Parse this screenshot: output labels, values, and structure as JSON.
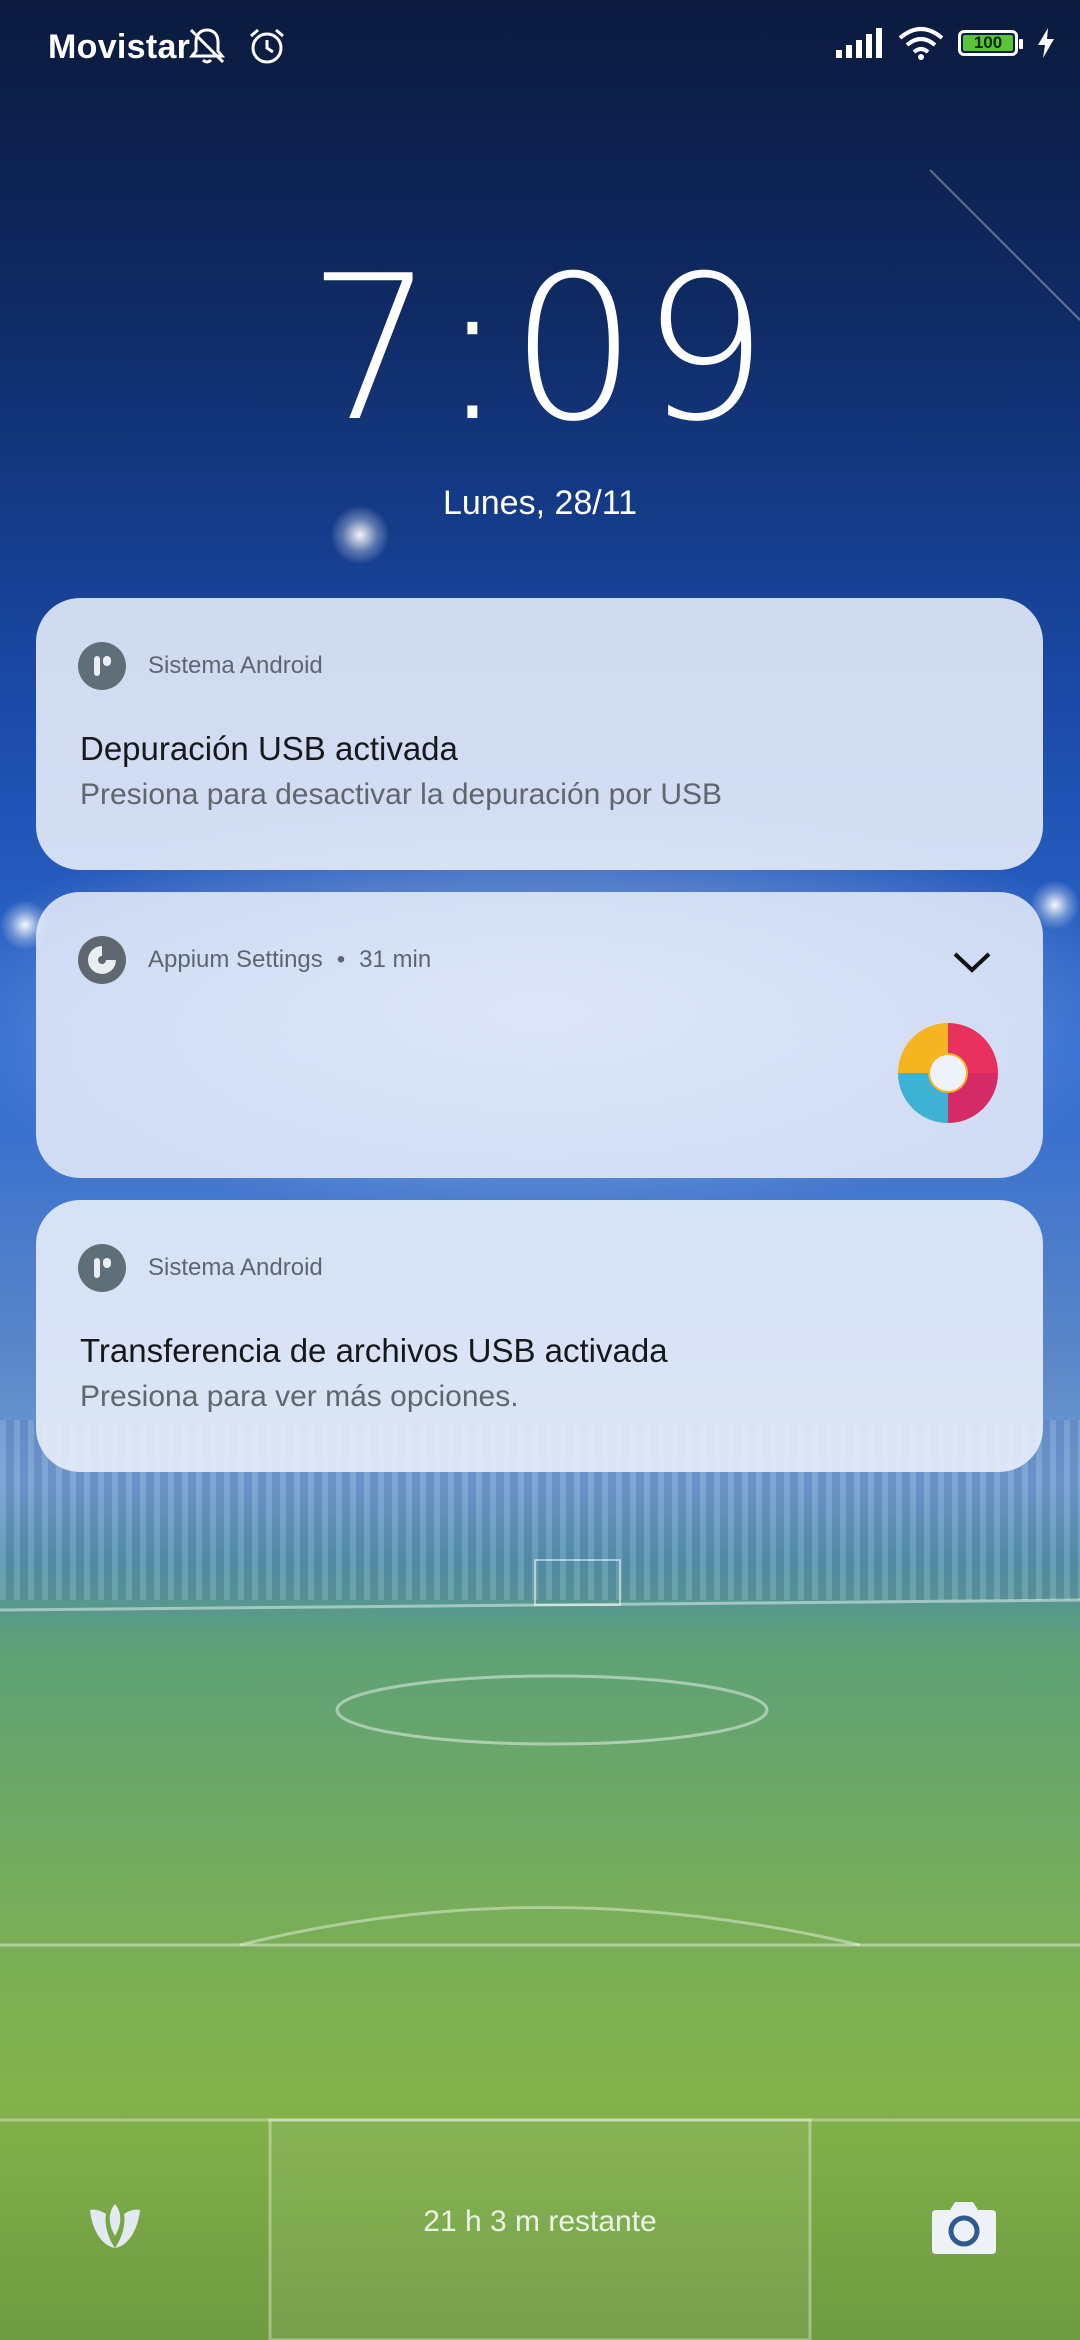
{
  "status_bar": {
    "carrier": "Movistar",
    "battery_level": "100",
    "icons_left": [
      "silent-icon",
      "alarm-icon"
    ],
    "icons_right": [
      "signal-icon",
      "wifi-icon",
      "battery-icon",
      "charging-icon"
    ]
  },
  "lockscreen": {
    "time": "7:09",
    "date": "Lunes, 28/11"
  },
  "notifications": [
    {
      "app_name": "Sistema Android",
      "title": "Depuración USB activada",
      "text": "Presiona para desactivar la depuración por USB"
    },
    {
      "app_name": "Appium Settings",
      "separator": "•",
      "time_ago": "31 min"
    },
    {
      "app_name": "Sistema Android",
      "title": "Transferencia de archivos USB activada",
      "text": "Presiona para ver más opciones."
    }
  ],
  "bottom": {
    "remaining": "21 h 3 m restante",
    "left_icon": "voice-assistant-icon",
    "right_icon": "camera-icon"
  },
  "colors": {
    "battery_fill": "#5ac33a",
    "notification_bg": "#ebf0fa"
  }
}
